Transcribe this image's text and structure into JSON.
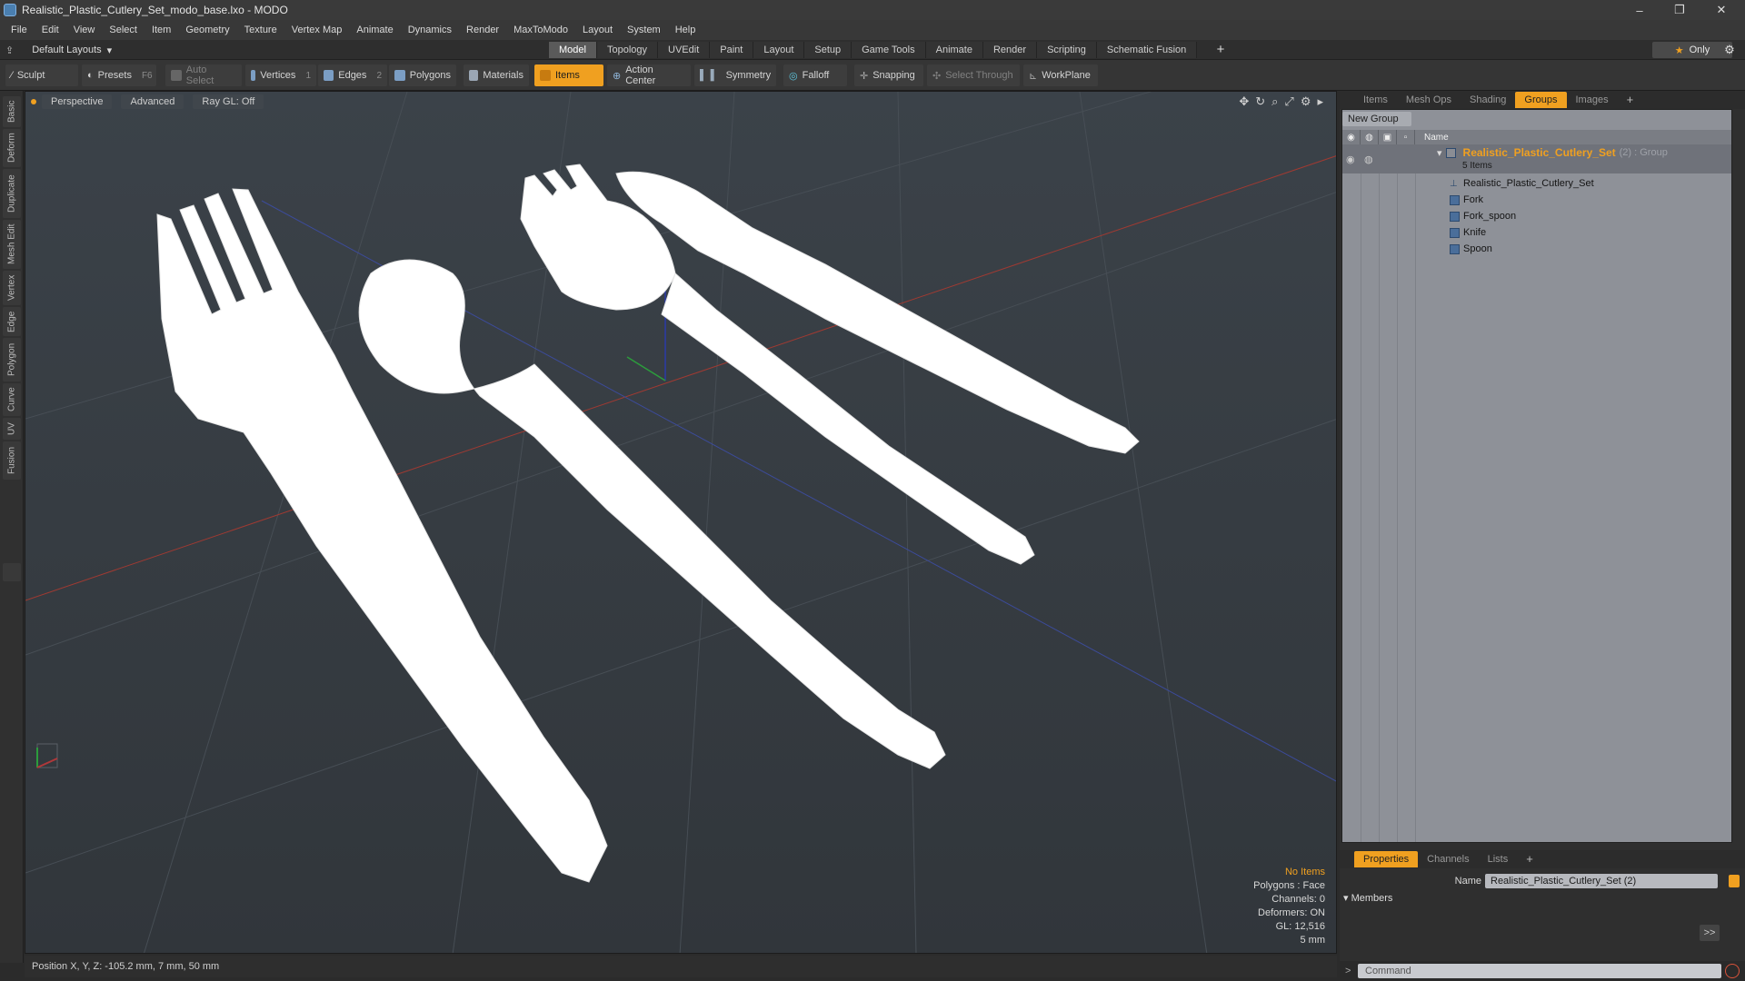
{
  "window": {
    "title": "Realistic_Plastic_Cutlery_Set_modo_base.lxo - MODO",
    "minimize": "–",
    "restore": "❐",
    "close": "✕"
  },
  "menu": [
    "File",
    "Edit",
    "View",
    "Select",
    "Item",
    "Geometry",
    "Texture",
    "Vertex Map",
    "Animate",
    "Dynamics",
    "Render",
    "MaxToModo",
    "Layout",
    "System",
    "Help"
  ],
  "layout": {
    "selector": "Default Layouts",
    "tabs": [
      "Model",
      "Topology",
      "UVEdit",
      "Paint",
      "Layout",
      "Setup",
      "Game Tools",
      "Animate",
      "Render",
      "Scripting",
      "Schematic Fusion"
    ],
    "active_tab": "Model",
    "add": "+",
    "only": "Only"
  },
  "toolbar": {
    "sculpt": "Sculpt",
    "presets": "Presets",
    "presets_key": "F6",
    "auto_select": "Auto Select",
    "vertices": "Vertices",
    "vertices_count": "1",
    "edges": "Edges",
    "edges_count": "2",
    "polygons": "Polygons",
    "materials": "Materials",
    "items": "Items",
    "action_center": "Action Center",
    "symmetry": "Symmetry",
    "falloff": "Falloff",
    "snapping": "Snapping",
    "select_through": "Select Through",
    "workplane": "WorkPlane"
  },
  "left_tabs": [
    "Basic",
    "Deform",
    "Duplicate",
    "Mesh Edit",
    "Vertex",
    "Edge",
    "Polygon",
    "Curve",
    "UV",
    "Fusion"
  ],
  "viewport": {
    "view": "Perspective",
    "shading": "Advanced",
    "raygl": "Ray GL: Off",
    "info": {
      "no_items": "No Items",
      "polygons": "Polygons : Face",
      "channels": "Channels: 0",
      "deformers": "Deformers: ON",
      "gl": "GL: 12,516",
      "scale": "5 mm"
    }
  },
  "status": {
    "position": "Position X, Y, Z:  -105.2 mm, 7 mm, 50 mm"
  },
  "right_panel": {
    "tabs": [
      "Items",
      "Mesh Ops",
      "Shading",
      "Groups",
      "Images"
    ],
    "active_tab": "Groups",
    "add": "+",
    "new_group": "New Group",
    "name_col": "Name",
    "group": {
      "name": "Realistic_Plastic_Cutlery_Set",
      "meta": "(2) : Group",
      "count": "5 Items"
    },
    "items": [
      "Realistic_Plastic_Cutlery_Set",
      "Fork",
      "Fork_spoon",
      "Knife",
      "Spoon"
    ]
  },
  "properties": {
    "tabs": [
      "Properties",
      "Channels",
      "Lists"
    ],
    "active_tab": "Properties",
    "add": "+",
    "name_label": "Name",
    "name_value": "Realistic_Plastic_Cutlery_Set (2)",
    "members": "Members",
    "arrow": ">>",
    "command_placeholder": "Command",
    "command_prompt": ">"
  }
}
